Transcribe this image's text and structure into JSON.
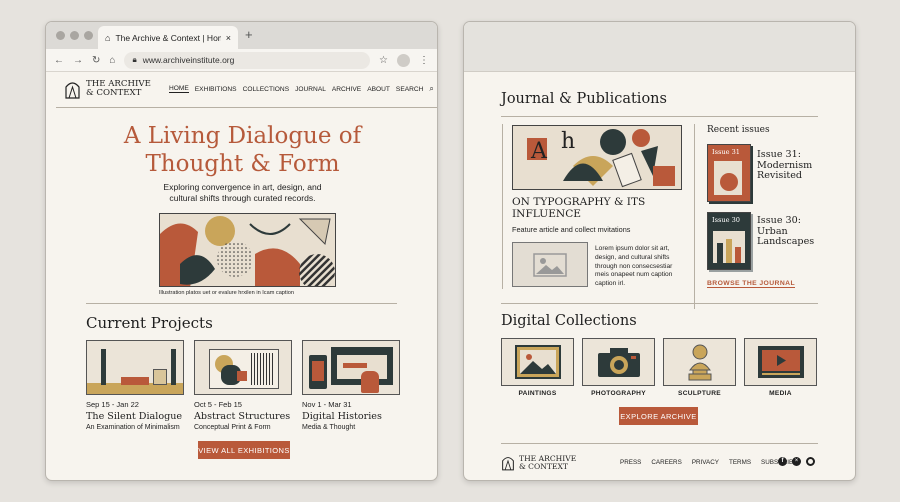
{
  "browser": {
    "tab_title": "The Archive & Context | Home",
    "url": "www.archiveinstitute.org"
  },
  "site": {
    "logo_line1": "THE ARCHIVE",
    "logo_line2": "& CONTEXT",
    "nav": [
      "HOME",
      "EXHIBITIONS",
      "COLLECTIONS",
      "JOURNAL",
      "ARCHIVE",
      "ABOUT",
      "SEARCH"
    ]
  },
  "hero": {
    "title_line1": "A Living Dialogue of",
    "title_line2": "Thought & Form",
    "subtitle_line1": "Exploring convergence in art, design, and",
    "subtitle_line2": "cultural shifts through curated records.",
    "caption": "Illustration platos uet or evalure hrxilen in Icam caption"
  },
  "projects": {
    "heading": "Current Projects",
    "items": [
      {
        "date": "Sep 15 - Jan 22",
        "title": "The Silent Dialogue",
        "subtitle": "An Examination of Minimalism"
      },
      {
        "date": "Oct 5 - Feb 15",
        "title": "Abstract Structures",
        "subtitle": "Conceptual Print & Form"
      },
      {
        "date": "Nov 1 - Mar 31",
        "title": "Digital Histories",
        "subtitle": "Media & Thought"
      }
    ],
    "cta": "VIEW ALL EXHIBITIONS"
  },
  "journal": {
    "heading": "Journal & Publications",
    "feature_title_line1": "ON TYPOGRAPHY & ITS",
    "feature_title_line2": "INFLUENCE",
    "feature_sub": "Feature article and collect mvitations",
    "lorem": [
      "Lorem ipsum dolor sit art,",
      "design, and cultural shifts",
      "through non consecsestiar",
      "meis onapeet num caption",
      "caption irl."
    ],
    "recent_label": "Recent issues",
    "issues": [
      {
        "badge": "Issue 31",
        "title": [
          "Issue 31:",
          "Modernism",
          "Revisited"
        ]
      },
      {
        "badge": "Issue 30",
        "title": [
          "Issue 30:",
          "Urban",
          "Landscapes"
        ]
      }
    ],
    "browse": "BROWSE THE JOURNAL"
  },
  "collections": {
    "heading": "Digital Collections",
    "items": [
      "PAINTINGS",
      "PHOTOGRAPHY",
      "SCULPTURE",
      "MEDIA"
    ],
    "cta": "EXPLORE ARCHIVE"
  },
  "footer": {
    "links": [
      "PRESS",
      "CAREERS",
      "PRIVACY",
      "TERMS",
      "SUBSCRIBE"
    ]
  },
  "colors": {
    "accent": "#b9593a",
    "background": "#f7f4ee",
    "ink": "#1f1f1f"
  }
}
